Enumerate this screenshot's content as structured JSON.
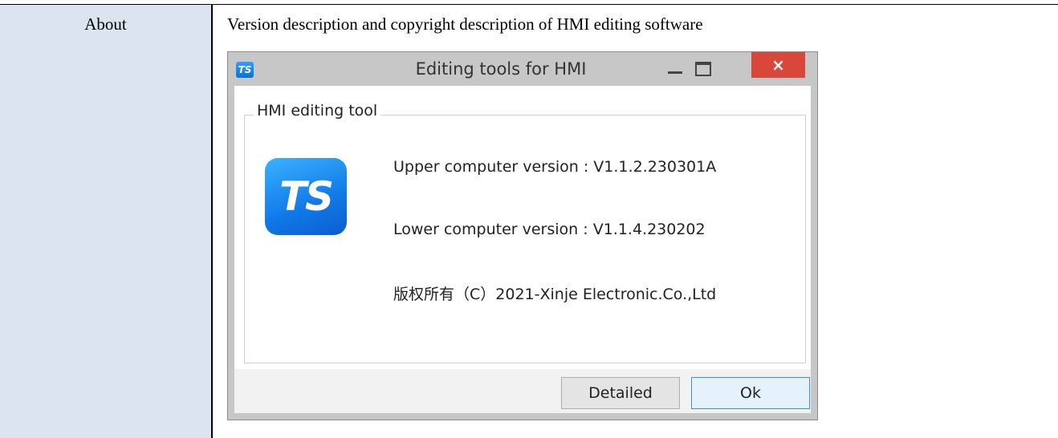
{
  "table": {
    "label": "About",
    "description": "Version description and copyright description of HMI editing software"
  },
  "dialog": {
    "app_icon_text": "TS",
    "title": "Editing tools for HMI",
    "close_glyph": "×",
    "group_title": "HMI editing tool",
    "logo_text": "TS",
    "upper_version": "Upper computer version : V1.1.2.230301A",
    "lower_version": "Lower computer version : V1.1.4.230202",
    "copyright": "版权所有（C）2021-Xinje Electronic.Co.,Ltd",
    "detailed_label": "Detailed",
    "ok_label": "Ok"
  },
  "colors": {
    "label_cell_bg": "#dbe4ef",
    "close_button": "#d9463a",
    "logo_blue": "#1179e8",
    "ok_border": "#3c8fd8"
  },
  "icons": [
    "app-icon",
    "minimize-icon",
    "maximize-icon",
    "close-icon",
    "ts-logo-icon"
  ]
}
